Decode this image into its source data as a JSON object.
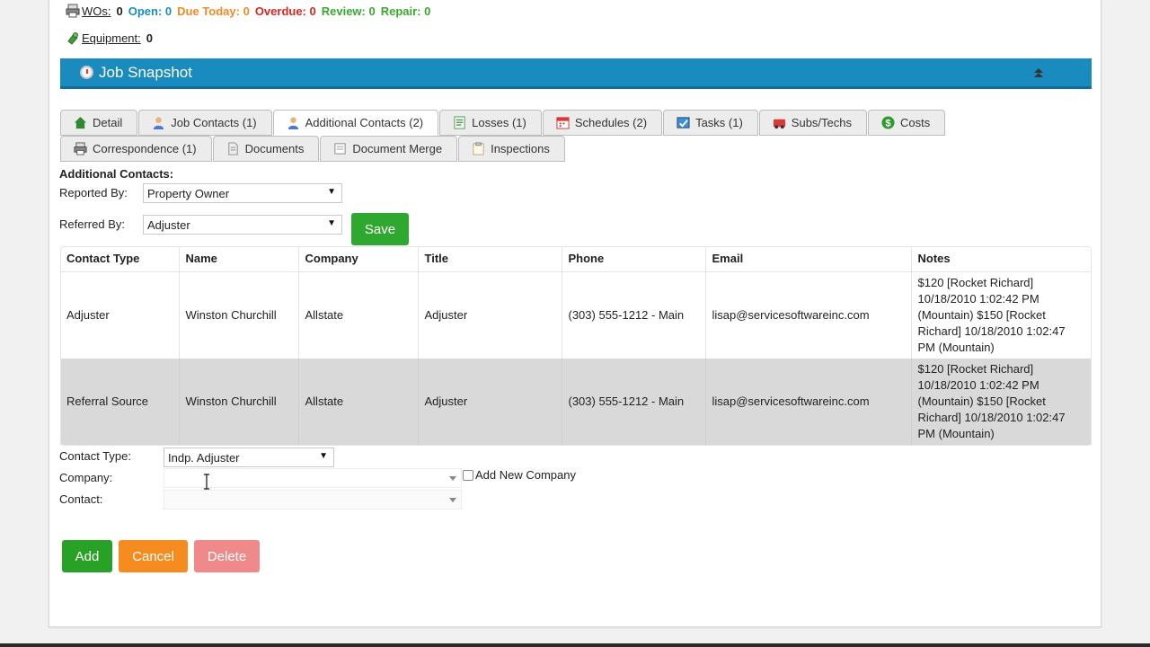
{
  "status": {
    "wos_label": "WOs:",
    "wos_count": "0",
    "open": "Open: 0",
    "due_today": "Due Today: 0",
    "overdue": "Overdue: 0",
    "review": "Review: 0",
    "repair": "Repair: 0",
    "equipment_label": "Equipment:",
    "equipment_count": "0"
  },
  "snapshot": {
    "title": "Job Snapshot"
  },
  "tabs_row1": [
    {
      "label": "Detail",
      "icon": "home-icon"
    },
    {
      "label": "Job Contacts (1)",
      "icon": "person-icon"
    },
    {
      "label": "Additional Contacts (2)",
      "icon": "person-icon"
    },
    {
      "label": "Losses (1)",
      "icon": "document-icon"
    },
    {
      "label": "Schedules (2)",
      "icon": "calendar-icon"
    },
    {
      "label": "Tasks (1)",
      "icon": "task-icon"
    },
    {
      "label": "Subs/Techs",
      "icon": "truck-icon"
    },
    {
      "label": "Costs",
      "icon": "dollar-icon"
    }
  ],
  "tabs_row2": [
    {
      "label": "Correspondence (1)",
      "icon": "printer-icon"
    },
    {
      "label": "Documents",
      "icon": "file-icon"
    },
    {
      "label": "Document Merge",
      "icon": "merge-icon"
    },
    {
      "label": "Inspections",
      "icon": "clipboard-icon"
    }
  ],
  "form": {
    "heading": "Additional Contacts:",
    "reported_by_label": "Reported By:",
    "reported_by_value": "Property Owner",
    "referred_by_label": "Referred By:",
    "referred_by_value": "Adjuster",
    "save_label": "Save"
  },
  "table": {
    "headers": [
      "Contact Type",
      "Name",
      "Company",
      "Title",
      "Phone",
      "Email",
      "Notes"
    ],
    "rows": [
      [
        "Adjuster",
        "Winston Churchill",
        "Allstate",
        "Adjuster",
        "(303) 555-1212 - Main",
        "lisap@servicesoftwareinc.com",
        "$120 [Rocket Richard] 10/18/2010 1:02:42 PM (Mountain) $150 [Rocket Richard] 10/18/2010 1:02:47 PM (Mountain)"
      ],
      [
        "Referral Source",
        "Winston Churchill",
        "Allstate",
        "Adjuster",
        "(303) 555-1212 - Main",
        "lisap@servicesoftwareinc.com",
        "$120 [Rocket Richard] 10/18/2010 1:02:42 PM (Mountain) $150 [Rocket Richard] 10/18/2010 1:02:47 PM (Mountain)"
      ]
    ]
  },
  "new_contact": {
    "contact_type_label": "Contact Type:",
    "contact_type_value": "Indp. Adjuster",
    "company_label": "Company:",
    "company_value": "",
    "add_new_company_label": "Add New Company",
    "contact_label": "Contact:",
    "contact_value": ""
  },
  "actions": {
    "add": "Add",
    "cancel": "Cancel",
    "delete": "Delete"
  },
  "colors": {
    "open": "#1a8bbf",
    "due_today": "#f08a24",
    "overdue": "#d9261c",
    "review": "#3aa72f",
    "repair": "#3aa72f",
    "header_bar": "#1a8bbf",
    "add": "#27a227",
    "cancel": "#f68b1f",
    "delete": "#f08a8a"
  }
}
